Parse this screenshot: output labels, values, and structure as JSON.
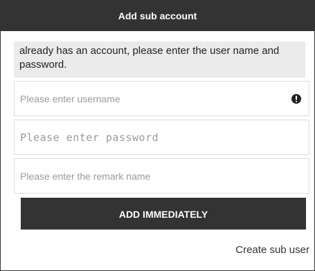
{
  "dialog": {
    "title": "Add sub account"
  },
  "notice": {
    "text": "already has an account, please enter the user name and password."
  },
  "form": {
    "username": {
      "value": "",
      "placeholder": "Please enter username"
    },
    "password": {
      "value": "",
      "placeholder": "Please enter password"
    },
    "remark": {
      "value": "",
      "placeholder": "Please enter the remark name"
    },
    "username_status_icon": "alert-circle-icon"
  },
  "actions": {
    "add_label": "ADD IMMEDIATELY",
    "create_sub_user_label": "Create sub user"
  },
  "colors": {
    "titlebar_bg": "#333333",
    "button_bg": "#333333",
    "notice_bg": "#ebebeb",
    "field_border": "#dddddd"
  }
}
